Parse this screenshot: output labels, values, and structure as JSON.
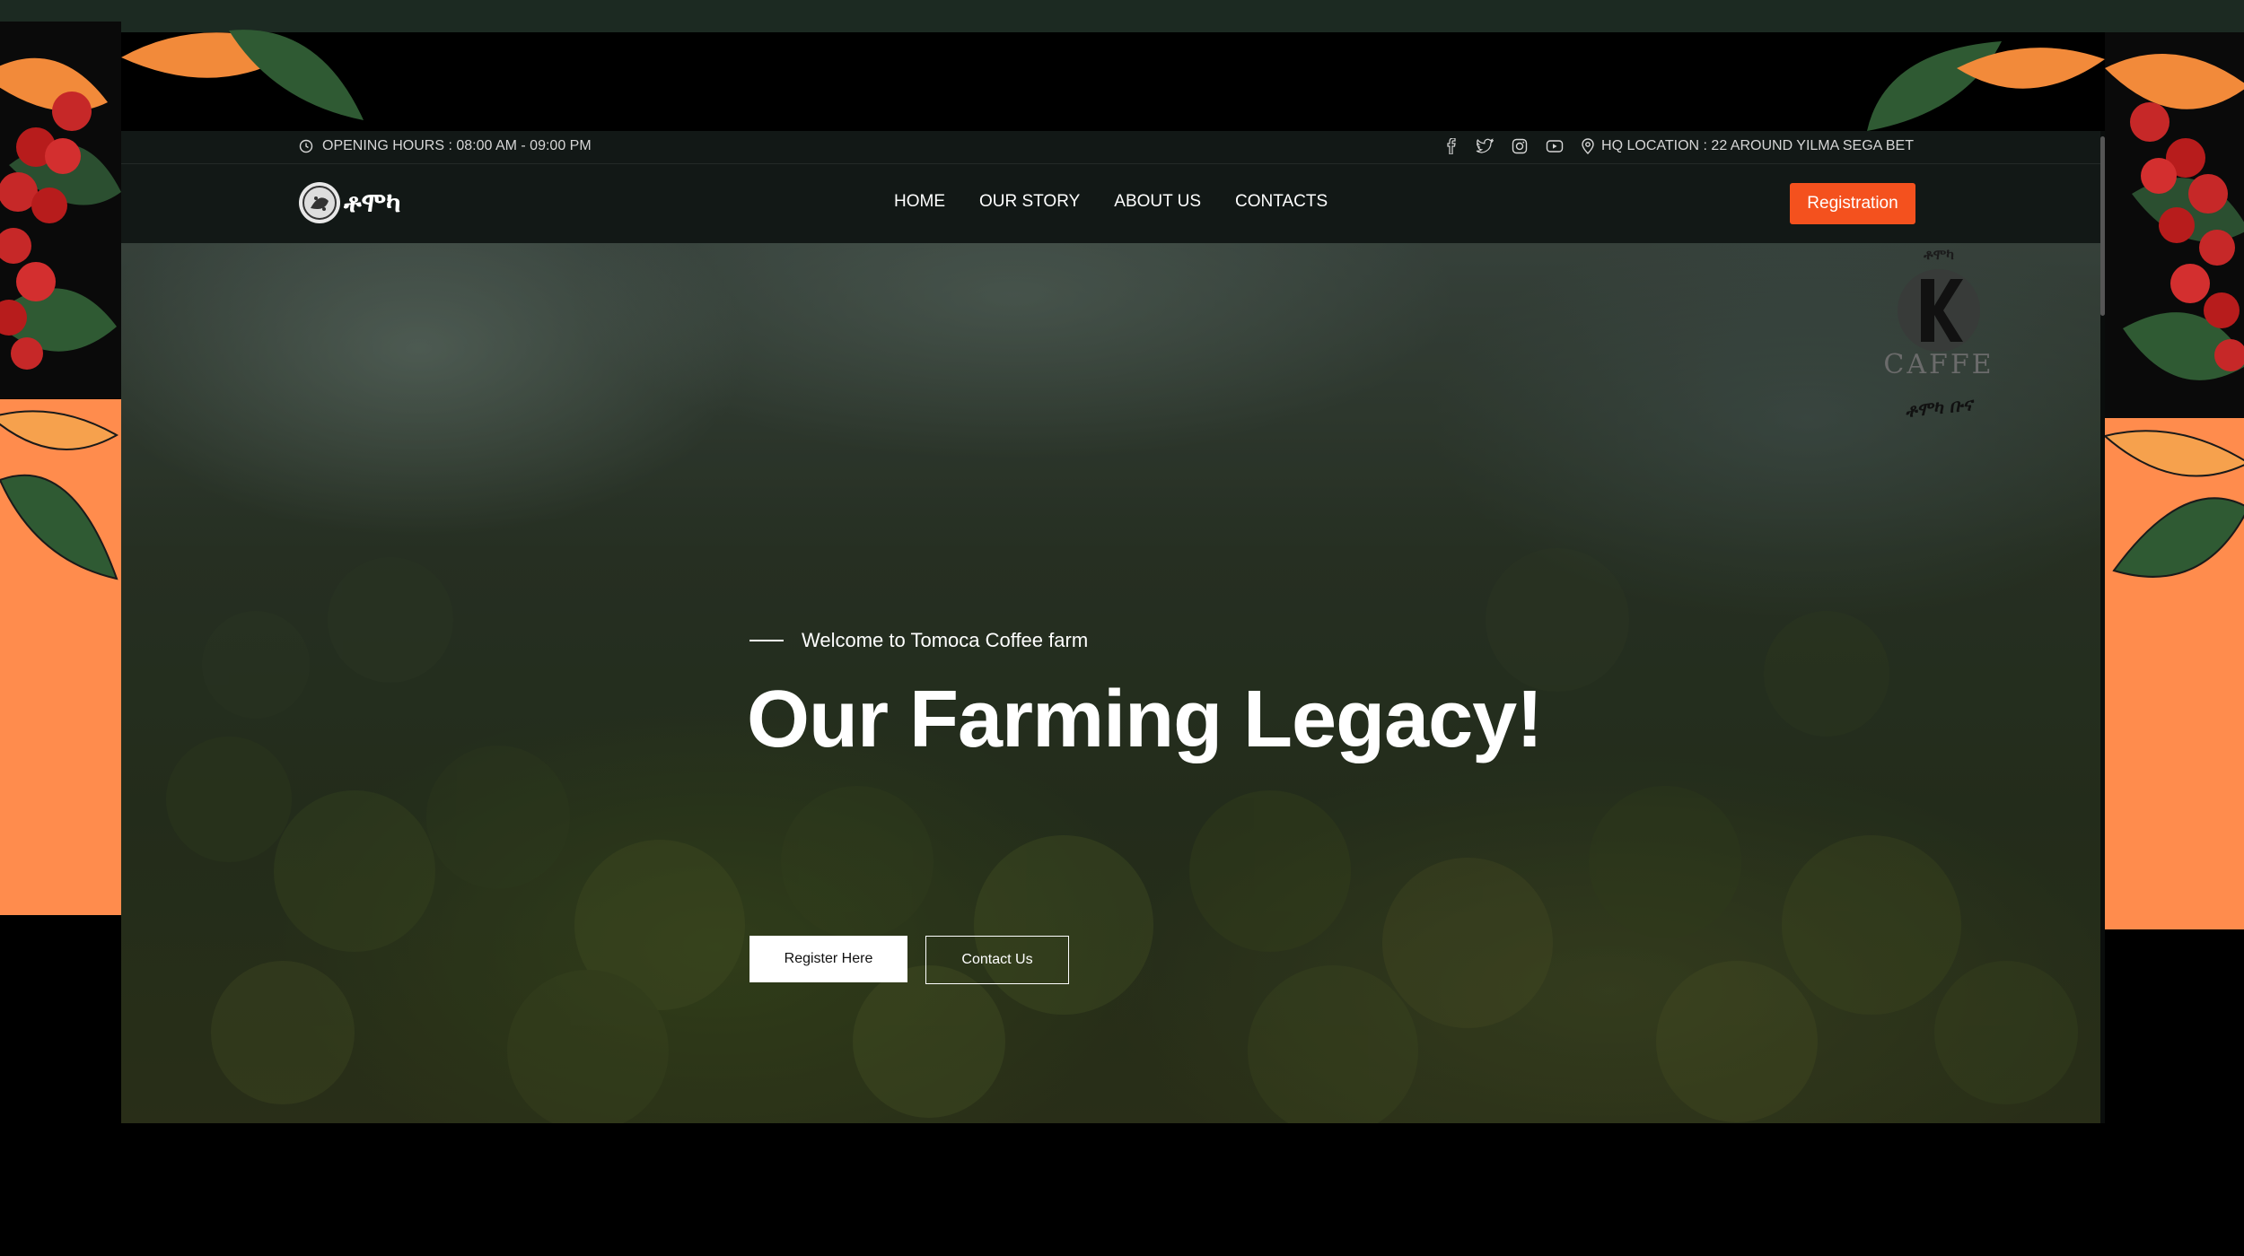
{
  "topbar": {
    "opening_hours": "OPENING HOURS : 08:00 AM - 09:00 PM",
    "hq_location": "HQ LOCATION : 22 AROUND YILMA SEGA BET",
    "social": [
      "facebook-icon",
      "twitter-icon",
      "instagram-icon",
      "youtube-icon"
    ]
  },
  "navbar": {
    "logo_text": "ቶሞካ",
    "links": [
      "HOME",
      "OUR STORY",
      "ABOUT US",
      "CONTACTS"
    ],
    "registration_label": "Registration"
  },
  "hero": {
    "eyebrow": "Welcome to Tomoca Coffee farm",
    "headline": "Our Farming Legacy!",
    "primary_button": "Register Here",
    "secondary_button": "Contact Us"
  },
  "watermark_logo": {
    "top_text": "ቶሞካ",
    "word": "CAFFE",
    "bottom_text": "ቶሞካ ቡና"
  },
  "colors": {
    "accent": "#f4511e",
    "dark_bg": "#121816",
    "side_orange": "#ff8c4d"
  }
}
